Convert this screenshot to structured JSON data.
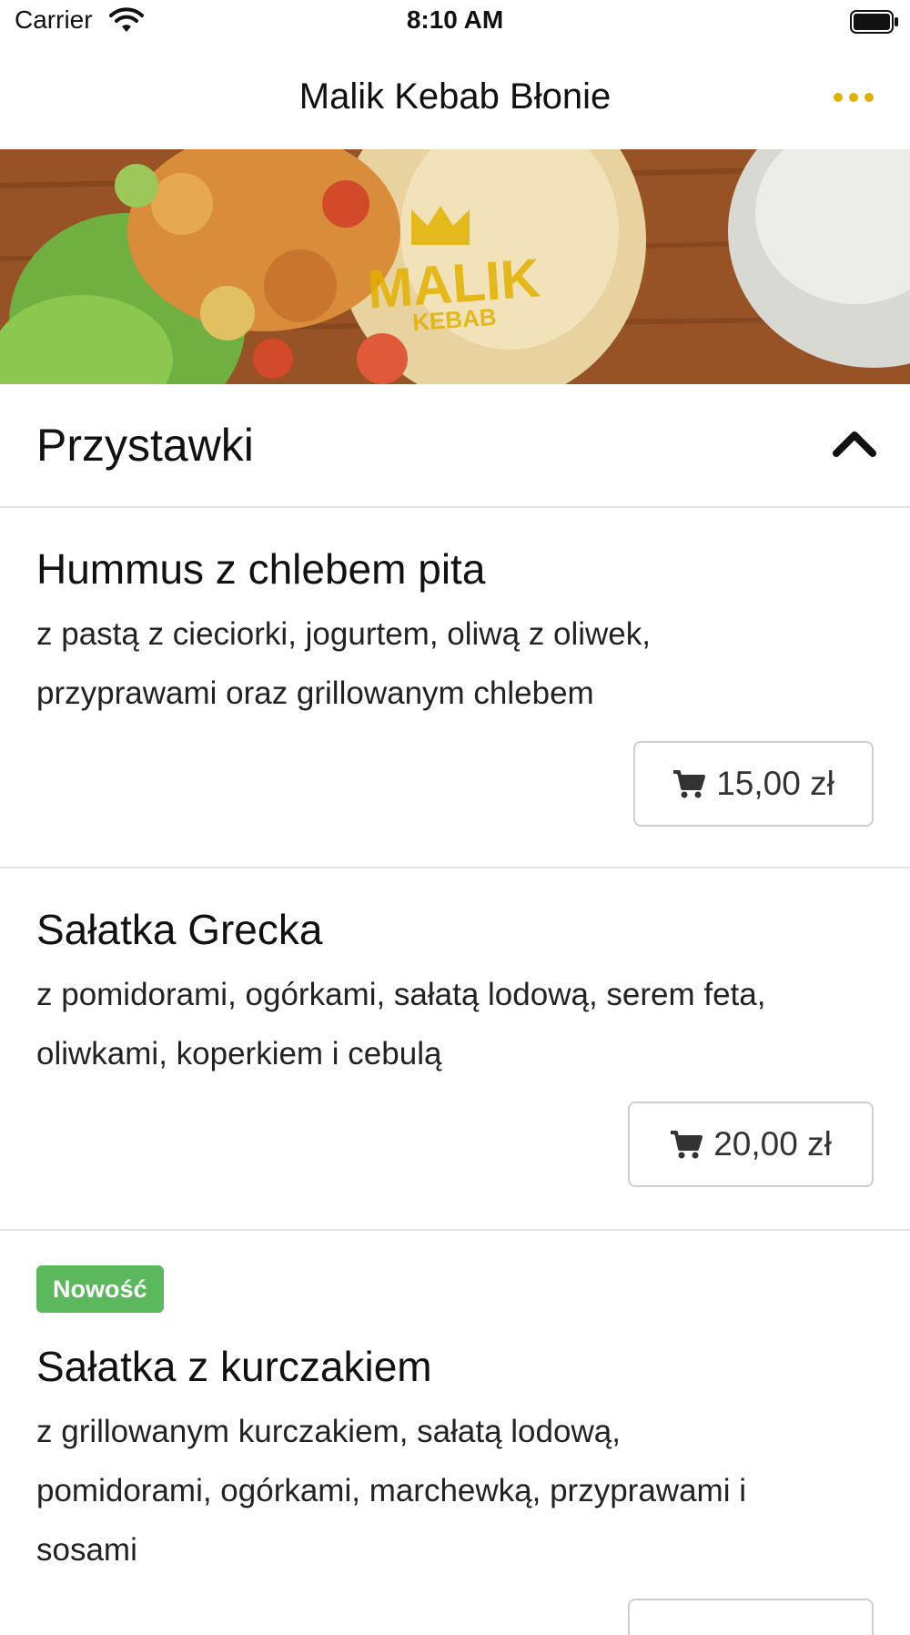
{
  "status_bar": {
    "carrier": "Carrier",
    "time": "8:10 AM"
  },
  "nav": {
    "title": "Malik Kebab Błonie"
  },
  "banner": {
    "logo_main": "MALIK",
    "logo_sub": "KEBAB"
  },
  "section": {
    "title": "Przystawki"
  },
  "items": [
    {
      "name": "Hummus z chlebem pita",
      "desc_line1": "z pastą z cieciorki, jogurtem, oliwą z oliwek,",
      "desc_line2": "przyprawami oraz grillowanym chlebem",
      "price": "15,00 zł"
    },
    {
      "name": "Sałatka Grecka",
      "desc_line1": "z pomidorami, ogórkami, sałatą lodową, serem feta,",
      "desc_line2": "oliwkami, koperkiem i cebulą",
      "price": "20,00 zł"
    },
    {
      "badge": "Nowość",
      "name": "Sałatka z kurczakiem",
      "desc_line1": "z grillowanym kurczakiem, sałatą lodową,",
      "desc_line2": "pomidorami, ogórkami, marchewką, przyprawami i",
      "desc_line3": "sosami"
    }
  ],
  "colors": {
    "accent": "#e2b100",
    "badge": "#5cb85c",
    "divider": "#e3e3e3"
  },
  "icons": {
    "more": "ellipsis-icon",
    "collapse": "chevron-up-icon",
    "cart": "cart-icon"
  }
}
